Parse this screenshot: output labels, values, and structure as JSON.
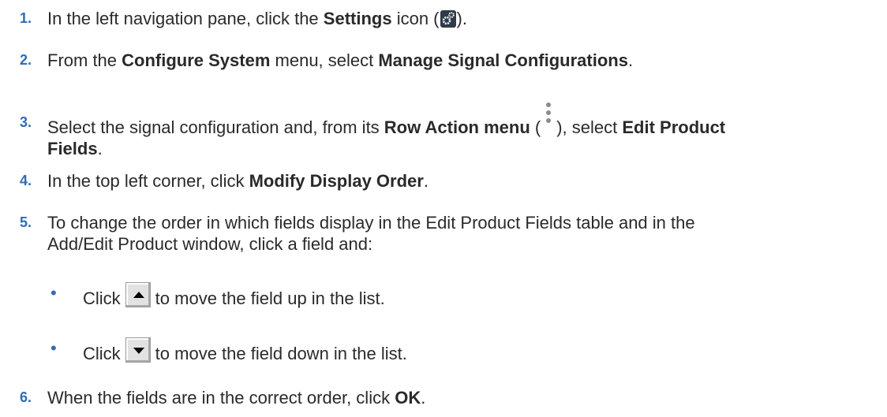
{
  "steps": [
    {
      "num": "1.",
      "a": "In the left navigation pane, click the ",
      "b1": "Settings",
      "c": " icon (",
      "icon": "settings-gear-icon",
      "d": ")."
    },
    {
      "num": "2.",
      "a": "From the ",
      "b1": "Configure System",
      "c": " menu, select ",
      "b2": "Manage Signal Configurations",
      "d": "."
    },
    {
      "num": "3.",
      "a": "Select the signal configuration and, from its ",
      "b1": "Row Action menu",
      "c": " (",
      "icon": "row-action-menu-icon",
      "d": "), select ",
      "b2a": "Edit Product",
      "b2b": "Fields",
      "e": "."
    },
    {
      "num": "4.",
      "a": "In the top left corner, click ",
      "b1": "Modify Display Order",
      "d": "."
    },
    {
      "num": "5.",
      "line1": "To change the order in which fields display in the Edit Product Fields table and in the",
      "line2": "Add/Edit Product window, click a field and:"
    },
    {
      "num": "6.",
      "a": "When the fields are in the correct order, click ",
      "b1": "OK",
      "d": "."
    }
  ],
  "substeps": [
    {
      "bullet": "•",
      "a": "Click",
      "icon": "move-up-arrow-icon",
      "b": "to move the field up in the list."
    },
    {
      "bullet": "•",
      "a": "Click",
      "icon": "move-down-arrow-icon",
      "b": "to move the field down in the list."
    }
  ]
}
